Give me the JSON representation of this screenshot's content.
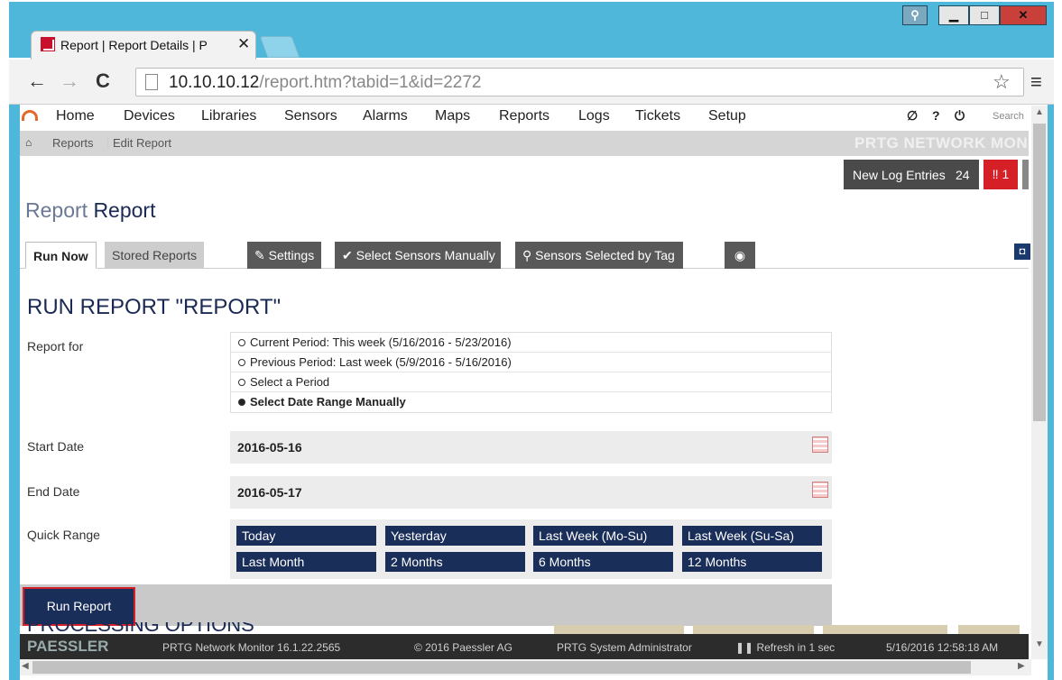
{
  "browser": {
    "tab_title": "Report | Report Details | P",
    "url_host": "10.10.10.12",
    "url_path": "/report.htm?tabid=1&id=2272"
  },
  "nav": {
    "items": [
      "Home",
      "Devices",
      "Libraries",
      "Sensors",
      "Alarms",
      "Maps",
      "Reports",
      "Logs",
      "Tickets",
      "Setup"
    ],
    "icons": [
      "∅",
      "?",
      "⏻"
    ],
    "search_placeholder": "Search"
  },
  "breadcrumb": [
    "Reports",
    "Edit Report"
  ],
  "brand": "PRTG NETWORK MON",
  "log": {
    "label": "New Log Entries",
    "count": "24",
    "alarm_count": "1"
  },
  "page": {
    "title_prefix": "Report",
    "title_name": "Report"
  },
  "tabs": [
    "Run Now",
    "Stored Reports",
    "Settings",
    "Select Sensors Manually",
    "Sensors Selected by Tag"
  ],
  "section_heading": "RUN REPORT \"REPORT\"",
  "form": {
    "report_for_label": "Report for",
    "options": [
      "Current Period: This week (5/16/2016 - 5/23/2016)",
      "Previous Period: Last week (5/9/2016 - 5/16/2016)",
      "Select a Period",
      "Select Date Range Manually"
    ],
    "selected_option": 3,
    "start_label": "Start Date",
    "start_value": "2016-05-16",
    "end_label": "End Date",
    "end_value": "2016-05-17",
    "quick_label": "Quick Range",
    "quick": [
      "Today",
      "Yesterday",
      "Last Week (Mo-Su)",
      "Last Week (Su-Sa)",
      "Last Month",
      "2 Months",
      "6 Months",
      "12 Months"
    ]
  },
  "run_button": "Run Report",
  "processing_heading": "PROCESSING OPTIONS",
  "footer": {
    "logo": "PAESSLER",
    "version": "PRTG Network Monitor 16.1.22.2565",
    "copyright": "© 2016 Paessler AG",
    "user": "PRTG System Administrator",
    "refresh": "Refresh in 1 sec",
    "datetime": "5/16/2016 12:58:18 AM"
  }
}
